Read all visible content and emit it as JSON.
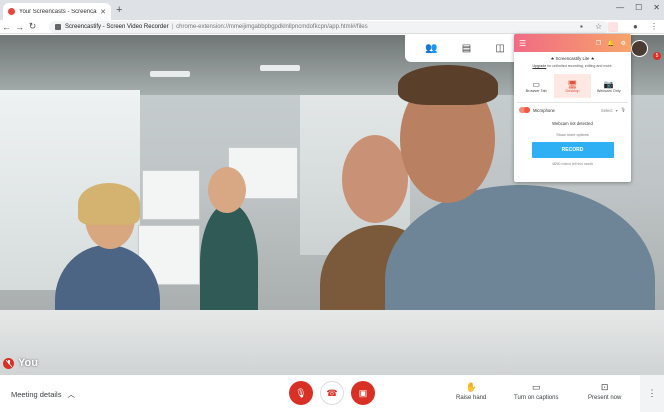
{
  "browser": {
    "tab_title": "Your Screencasts - Screencastify",
    "url_title": "Screencastify - Screen Video Recorder",
    "url_path": "chrome-extension://mmeijimgabbpbgpdklnllpncmdofkcpn/app.html#/files"
  },
  "meeting": {
    "self_label": "You",
    "details_label": "Meeting details",
    "raise_hand_label": "Raise hand",
    "captions_label": "Turn on captions",
    "present_label": "Present now",
    "notification_count": "5"
  },
  "popup": {
    "title": "★ Screencastify Lite ★",
    "upgrade_link": "Upgrade",
    "upgrade_text": " for unlimited recording, editing and more.",
    "modes": [
      {
        "label": "Browser Tab",
        "icon": "browser-tab-icon"
      },
      {
        "label": "Desktop",
        "icon": "desktop-icon"
      },
      {
        "label": "Webcam Only",
        "icon": "webcam-icon"
      }
    ],
    "active_mode": "Desktop",
    "microphone_label": "Microphone",
    "microphone_select": "Select",
    "webcam_status": "Webcam not detected",
    "more_options": "Show more options",
    "record_label": "RECORD",
    "videos_left": "48/50 videos left this month"
  },
  "colors": {
    "popup_gradient_start": "#f06b84",
    "popup_gradient_end": "#f7a46a",
    "record_button": "#2fb0f4",
    "meet_red": "#d93025"
  }
}
